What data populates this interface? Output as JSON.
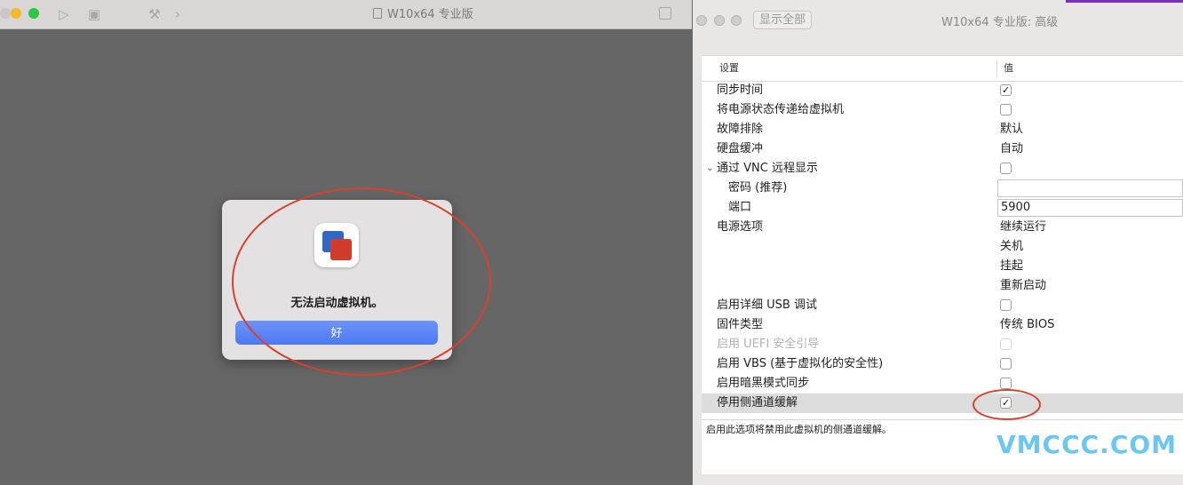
{
  "vm_window": {
    "title": "W10x64 专业版",
    "icons": [
      "play-icon",
      "snapshot-icon",
      "wrench-icon",
      "chevron-right-icon",
      "fullscreen-icon"
    ]
  },
  "dialog": {
    "message": "无法启动虚拟机。",
    "ok_label": "好"
  },
  "settings_window": {
    "show_all_label": "显示全部",
    "title": "W10x64 专业版: 高级",
    "columns": {
      "setting": "设置",
      "value": "值"
    },
    "rows": {
      "sync_time": {
        "label": "同步时间",
        "checked": true
      },
      "pass_power": {
        "label": "将电源状态传递给虚拟机",
        "checked": false
      },
      "troubleshoot": {
        "label": "故障排除",
        "value": "默认"
      },
      "disk_cache": {
        "label": "硬盘缓冲",
        "value": "自动"
      },
      "vnc": {
        "label": "通过 VNC 远程显示",
        "checked": false
      },
      "password": {
        "label": "密码 (推荐)",
        "value": ""
      },
      "port": {
        "label": "端口",
        "value": "5900"
      },
      "power_options": {
        "label": "电源选项",
        "values": [
          "继续运行",
          "关机",
          "挂起",
          "重新启动"
        ]
      },
      "usb_debug": {
        "label": "启用详细 USB 调试",
        "checked": false
      },
      "firmware": {
        "label": "固件类型",
        "value": "传统 BIOS"
      },
      "uefi": {
        "label": "启用 UEFI 安全引导",
        "checked": false
      },
      "vbs": {
        "label": "启用 VBS (基于虚拟化的安全性)",
        "checked": false
      },
      "dark_mode": {
        "label": "启用暗黑模式同步",
        "checked": false
      },
      "side_channel": {
        "label": "停用侧通道缓解",
        "checked": true
      }
    },
    "description": "启用此选项将禁用此虚拟机的侧通道缓解。",
    "check_glyph": "✓"
  },
  "watermark": "VMCCC.COM",
  "colors": {
    "annotation": "#d8412b",
    "button": "#5a84f5",
    "watermark": "#6cc6f2"
  }
}
